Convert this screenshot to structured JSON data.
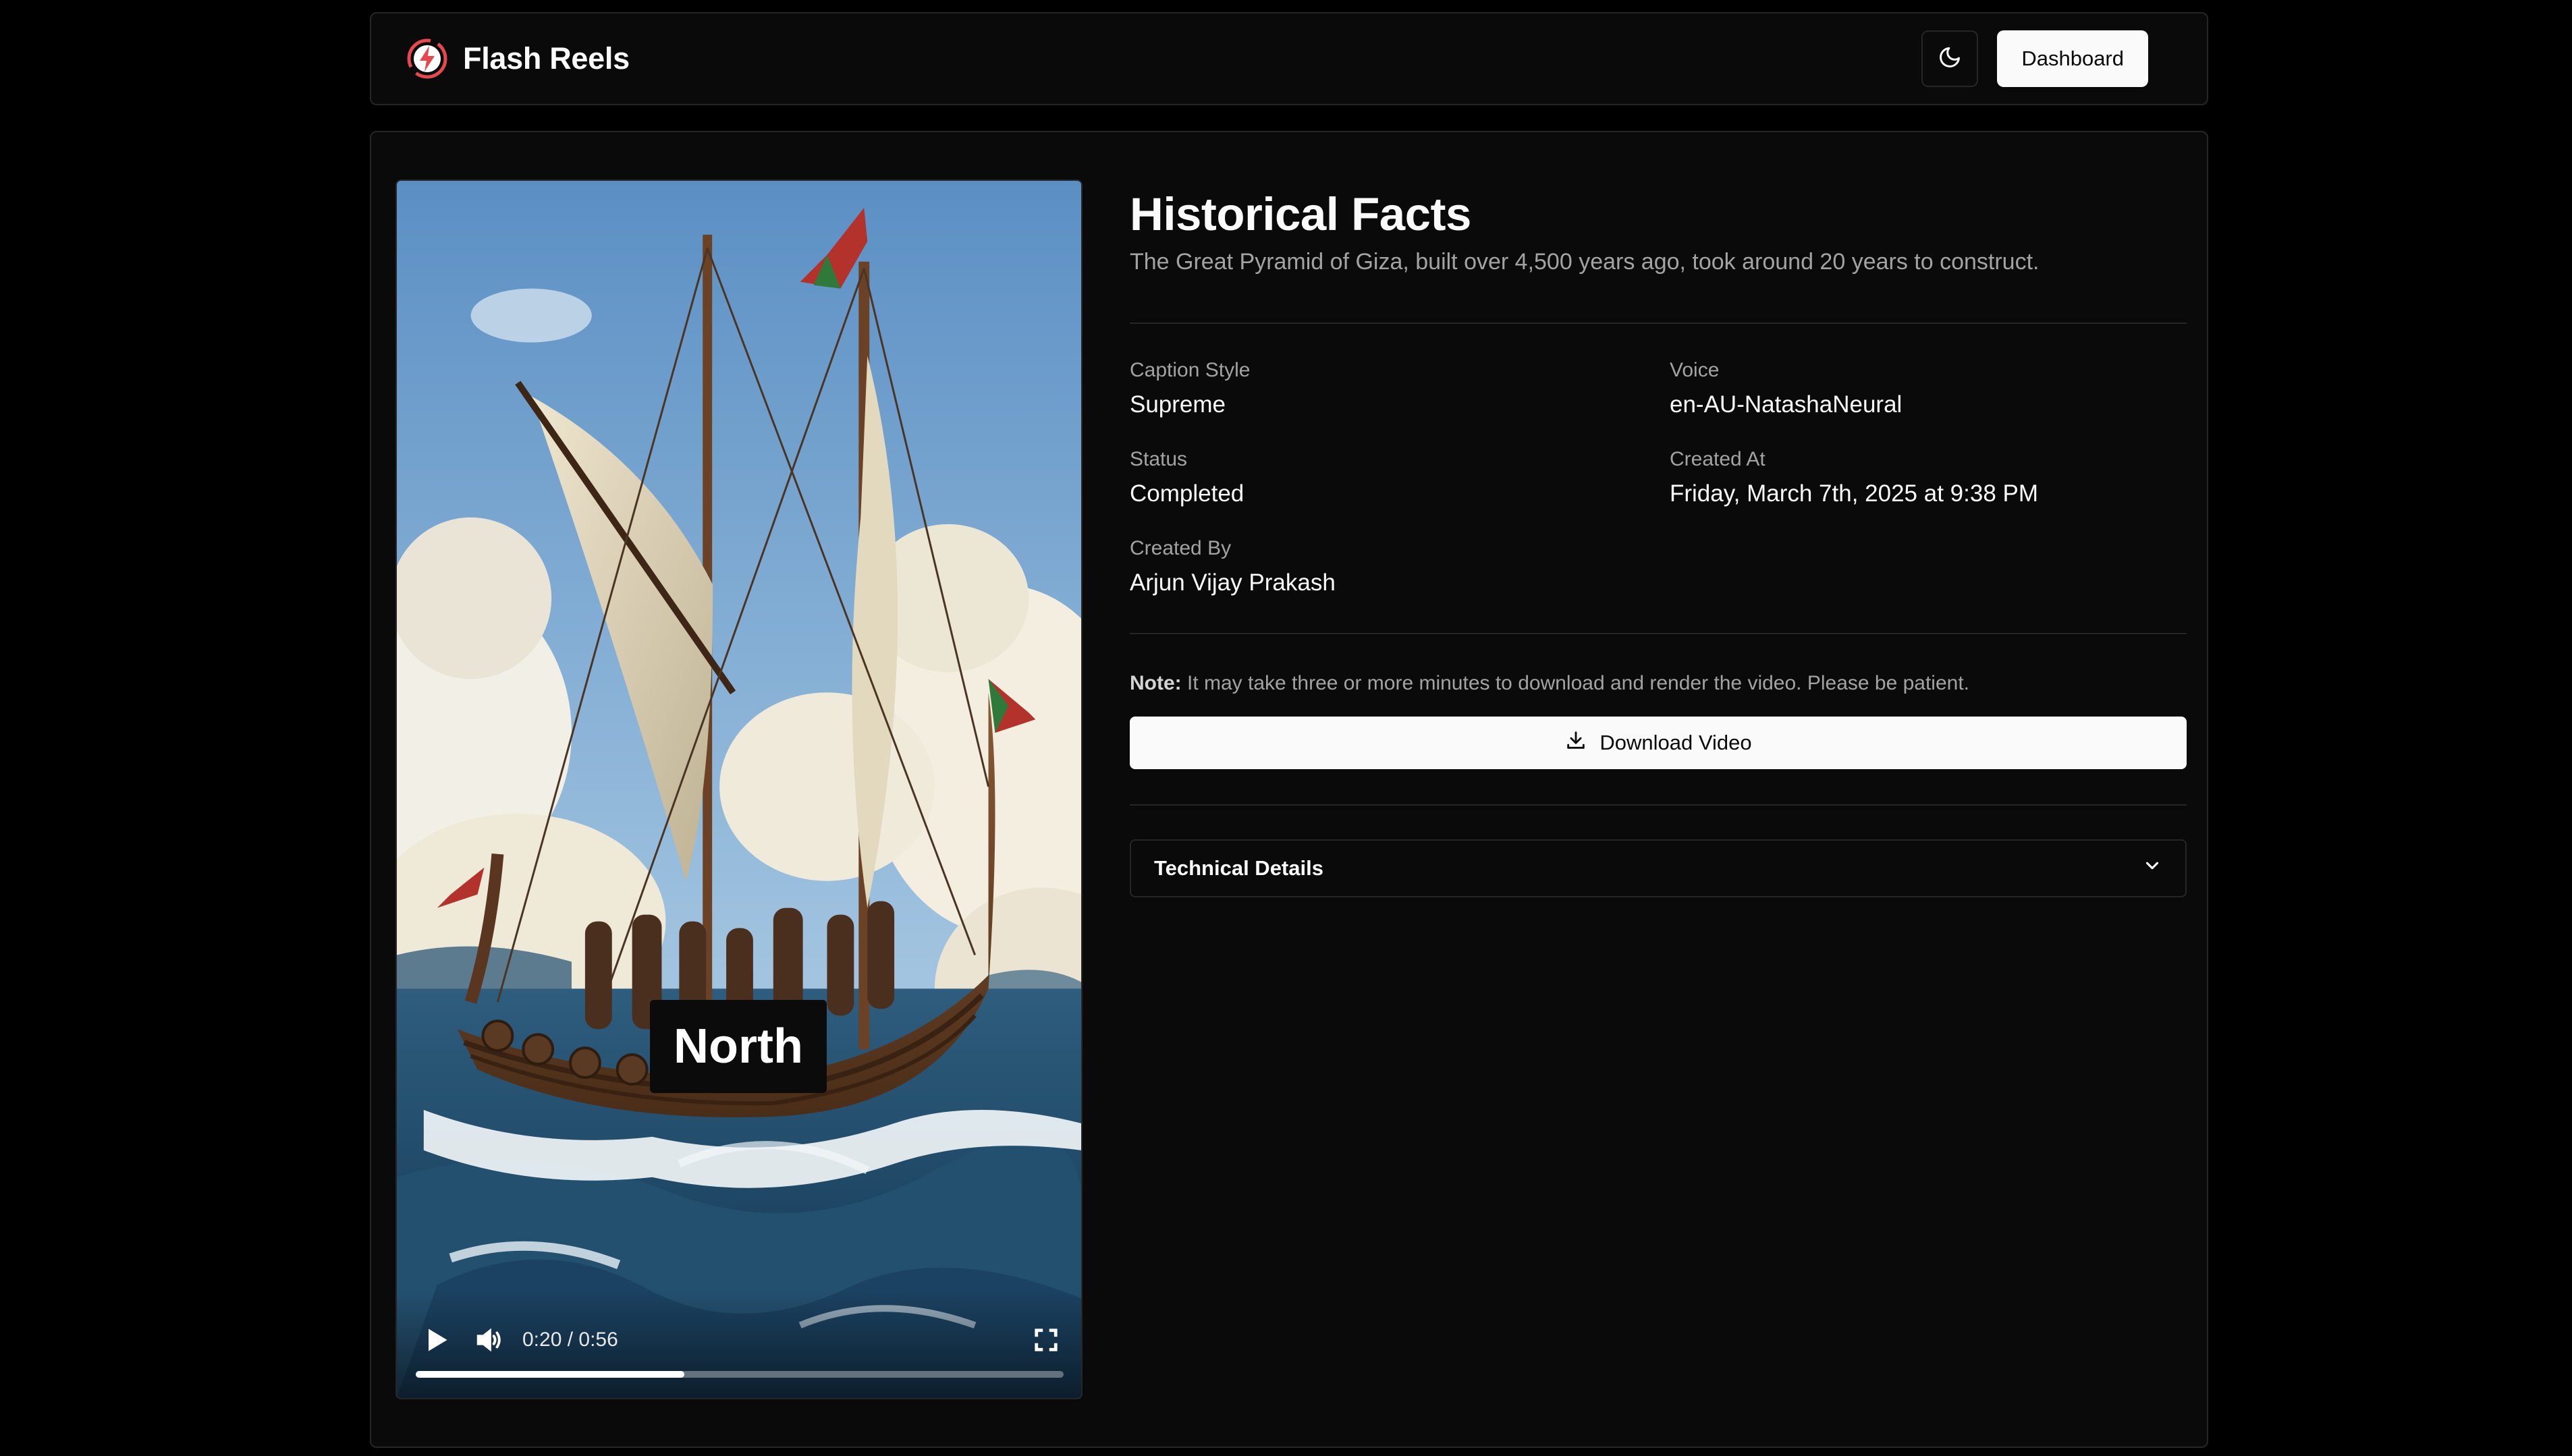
{
  "header": {
    "brand_name": "Flash Reels",
    "logo_icon": "lightning-logo-icon",
    "theme_icon": "moon-icon",
    "dashboard_label": "Dashboard"
  },
  "video": {
    "caption_word": "North",
    "time_display": "0:20 / 0:56",
    "progress": 0.415,
    "play_icon": "play-icon",
    "volume_icon": "volume-icon",
    "fullscreen_icon": "fullscreen-icon"
  },
  "reel": {
    "title": "Historical Facts",
    "description": "The Great Pyramid of Giza, built over 4,500 years ago, took around 20 years to construct.",
    "fields": [
      {
        "label": "Caption Style",
        "value": "Supreme"
      },
      {
        "label": "Voice",
        "value": "en-AU-NatashaNeural"
      },
      {
        "label": "Status",
        "value": "Completed"
      },
      {
        "label": "Created At",
        "value": "Friday, March 7th, 2025 at 9:38 PM"
      },
      {
        "label": "Created By",
        "value": "Arjun Vijay Prakash"
      }
    ],
    "note_label": "Note:",
    "note_text": "It may take three or more minutes to download and render the video. Please be patient.",
    "download_label": "Download Video",
    "download_icon": "download-icon",
    "technical_details_label": "Technical Details",
    "accordion_icon": "chevron-down-icon"
  },
  "colors": {
    "background": "#000000",
    "surface": "#0a0a0a",
    "border": "#262626",
    "muted_text": "#a3a3a3",
    "logo_accent": "#e5484d"
  }
}
